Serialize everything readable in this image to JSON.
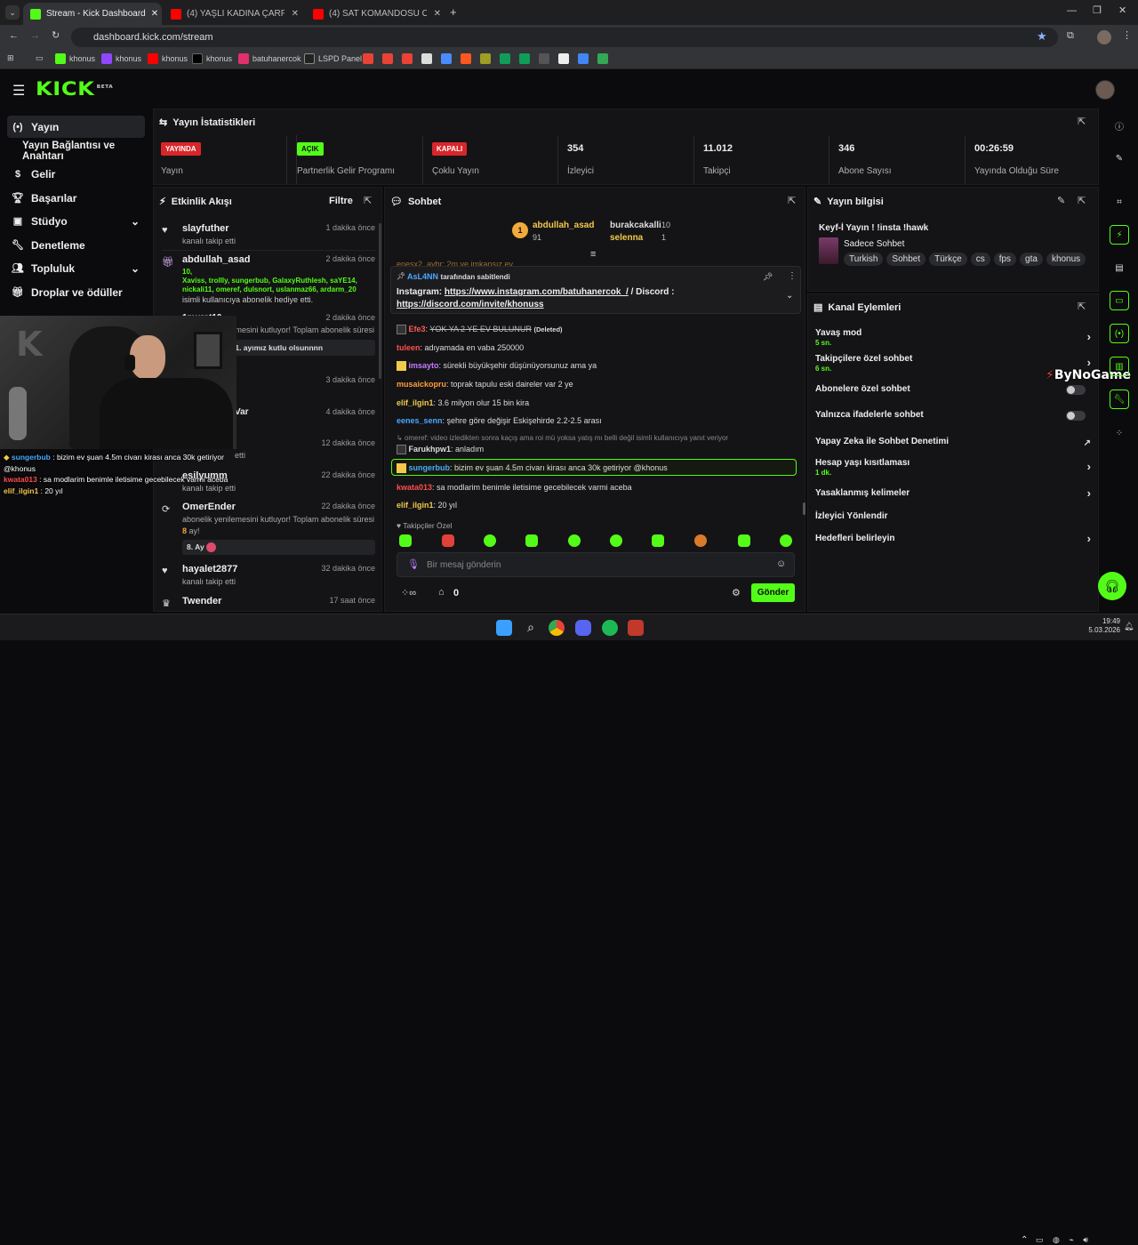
{
  "browser": {
    "tabs": [
      {
        "title": "Stream - Kick Dashboard",
        "active": true
      },
      {
        "title": "(4) YAŞLI KADINA ÇARPTI! Türk",
        "active": false
      },
      {
        "title": "(4) SAT KOMANDOSU OLMAYI",
        "active": false
      }
    ],
    "url": "dashboard.kick.com/stream",
    "bookmarks": [
      "khonus",
      "khonus",
      "khonus",
      "khonus",
      "batuhanercok",
      "LSPD Panel"
    ]
  },
  "app": {
    "logo": "KICK",
    "logo_beta": "BETA",
    "accent": "#53fc18"
  },
  "sidebar": {
    "items": [
      {
        "label": "Yayın",
        "icon": "broadcast-icon",
        "selected": true
      },
      {
        "label": "Yayın Bağlantısı ve Anahtarı",
        "icon": "",
        "selected": false
      },
      {
        "label": "Gelir",
        "icon": "dollar-icon",
        "selected": false
      },
      {
        "label": "Başarılar",
        "icon": "trophy-icon",
        "selected": false
      },
      {
        "label": "Stüdyo",
        "icon": "studio-icon",
        "selected": false
      },
      {
        "label": "Denetleme",
        "icon": "wrench-icon",
        "selected": false
      },
      {
        "label": "Topluluk",
        "icon": "community-icon",
        "selected": false
      },
      {
        "label": "Droplar ve ödüller",
        "icon": "gift-icon",
        "selected": false
      }
    ]
  },
  "stats": {
    "title": "Yayın İstatistikleri",
    "items": [
      {
        "badge": "YAYINDA",
        "badge_color": "#d9262a",
        "label": "Yayın"
      },
      {
        "badge": "AÇIK",
        "badge_color": "#53fc18",
        "label": "Partnerlik Gelir Programı"
      },
      {
        "badge": "KAPALI",
        "badge_color": "#d9262a",
        "label": "Çoklu Yayın"
      },
      {
        "value": "354",
        "label": "İzleyici"
      },
      {
        "value": "11.012",
        "label": "Takipçi"
      },
      {
        "value": "346",
        "label": "Abone Sayısı"
      },
      {
        "value": "00:26:59",
        "label": "Yayında Olduğu Süre"
      }
    ]
  },
  "activity": {
    "title": "Etkinlik Akışı",
    "filter": "Filtre",
    "events": [
      {
        "name": "slayfuther",
        "sub": "kanalı takip etti",
        "time": "1 dakika önce",
        "icon": "heart-icon"
      },
      {
        "name": "abdullah_asad",
        "gift_count": "10,",
        "gift_list": "Xaviss, trollly, sungerbub, GalaxyRuthlesh, saYE14, nickali11, omeref, dulsnort, uslanmaz66, ardarm_20",
        "sub": "isimli kullanıcıya abonelik hediye etti.",
        "time": "2 dakika önce",
        "icon": "gift-icon"
      },
      {
        "name": "1murat10",
        "sub": "abonelik yenilemesini kutluyor! Toplam abonelik süresi -",
        "highlight": "iyi yayınlarr 21. ayımız kutlu olsunnnn",
        "time": "2 dakika önce"
      },
      {
        "name": "",
        "sub": "",
        "time": "3 dakika önce"
      },
      {
        "name": "Var",
        "sub": "",
        "time": "4 dakika önce"
      },
      {
        "name": "",
        "sub": "etti",
        "time": "12 dakika önce"
      },
      {
        "name": "esilyumm",
        "sub": "kanalı takip etti",
        "time": "22 dakika önce"
      },
      {
        "name": "OmerEnder",
        "sub": "abonelik yenilemesini kutluyor! Toplam abonelik süresi -",
        "months": "8",
        "months_suffix": "ay!",
        "highlight": "8. Ay",
        "time": "22 dakika önce",
        "icon": "renew-icon"
      },
      {
        "name": "hayalet2877",
        "sub": "kanalı takip etti",
        "time": "32 dakika önce",
        "icon": "heart-icon"
      },
      {
        "name": "Twender",
        "sub": "",
        "time": "17 saat önce",
        "icon": "crown-icon"
      }
    ]
  },
  "chat": {
    "title": "Sohbet",
    "leaders": [
      {
        "rank": "1",
        "name": "abdullah_asad",
        "amount": "91"
      },
      {
        "name": "burakcakalli",
        "amount": "10"
      },
      {
        "name": "selenna",
        "amount": "1"
      }
    ],
    "pinned": {
      "user": "AsL4NN",
      "label": "tarafından sabitlendi",
      "text_prefix": "Instagram:",
      "link1": "https://www.instagram.com/batuhanercok_/",
      "text_mid": "/ Discord :",
      "link2": "https://discord.com/invite/khonuss"
    },
    "partial_top": "enesx2_aybr: 2m ve imkansız ev",
    "messages": [
      {
        "user": "Efe3",
        "color": "#ff5a5a",
        "text": "YOK YA 2 YE EV BULUNUR",
        "deleted": "(Deleted)",
        "badge": true
      },
      {
        "user": "tuleen",
        "color": "#ff4d4d",
        "text": "adıyamada en vaba 250000"
      },
      {
        "user": "imsayto",
        "color": "#c67bff",
        "text": "sürekli büyükşehir düşünüyorsunuz ama ya",
        "badge": true
      },
      {
        "user": "musaickopru",
        "color": "#ff9c3a",
        "text": "toprak tapulu eski daireler var 2 ye"
      },
      {
        "user": "elif_ilgin1",
        "color": "#f2c94c",
        "text": "3.6 milyon olur 15 bin kira"
      },
      {
        "user": "eenes_senn",
        "color": "#4aa8ff",
        "text": "şehre göre değişir Eskişehirde 2.2-2.5 arası"
      },
      {
        "reply": "omeref: video izledikten sonra kaçış ama roi mü yoksa yatış mı belli değil isimli kullanıcıya yanıt veriyor"
      },
      {
        "user": "Farukhpw1",
        "color": "#ddd",
        "text": "anladım",
        "badge": true
      },
      {
        "user": "sungerbub",
        "color": "#4aa8ff",
        "text": "bizim ev şuan 4.5m civarı kirası anca 30k getiriyor @khonus",
        "badge": true,
        "mention": true
      },
      {
        "user": "kwata013",
        "color": "#ff4d4d",
        "text": "sa modlarim benimle iletisime gecebilecek varmi aceba"
      },
      {
        "user": "elif_ilgin1",
        "color": "#f2c94c",
        "text": "20 yıl"
      }
    ],
    "follower_only": "Takipçiler Özel",
    "input_placeholder": "Bir mesaj gönderin",
    "count": "0",
    "send": "Gönder"
  },
  "overlay_chat": [
    {
      "user": "sungerbub",
      "text": "bizim ev şuan 4.5m civarı kirası anca 30k getiriyor @khonus"
    },
    {
      "user": "kwata013",
      "text": "sa modlarim benimle iletisime gecebilecek varmi aceba"
    },
    {
      "user": "elif_ilgin1",
      "text": "20 yıl"
    }
  ],
  "stream_info": {
    "title": "Yayın bilgisi",
    "stream_title": "Keyf-İ Yayın ! !insta !hawk",
    "category": "Sadece Sohbet",
    "tags": [
      "Turkish",
      "Sohbet",
      "Türkçe",
      "cs",
      "fps",
      "gta",
      "khonus"
    ]
  },
  "actions": {
    "title": "Kanal Eylemleri",
    "items": [
      {
        "label": "Yavaş mod",
        "sub": "5 sn.",
        "control": "chevron"
      },
      {
        "label": "Takipçilere özel sohbet",
        "sub": "6 sn.",
        "control": "chevron"
      },
      {
        "label": "Abonelere özel sohbet",
        "sub": "",
        "control": "toggle"
      },
      {
        "label": "Yalnızca ifadelerle sohbet",
        "sub": "",
        "control": "toggle"
      },
      {
        "label": "Yapay Zeka ile Sohbet Denetimi",
        "sub": "",
        "control": "external"
      },
      {
        "label": "Hesap yaşı kısıtlaması",
        "sub": "1 dk.",
        "control": "chevron"
      },
      {
        "label": "Yasaklanmış kelimeler",
        "sub": "",
        "control": "chevron"
      },
      {
        "label": "İzleyici Yönlendir",
        "sub": "",
        "control": "none"
      },
      {
        "label": "Hedefleri belirleyin",
        "sub": "",
        "control": "chevron"
      }
    ]
  },
  "watermark": "ByNoGame",
  "taskbar": {
    "time": "19:49",
    "date": "5.03.2026"
  }
}
